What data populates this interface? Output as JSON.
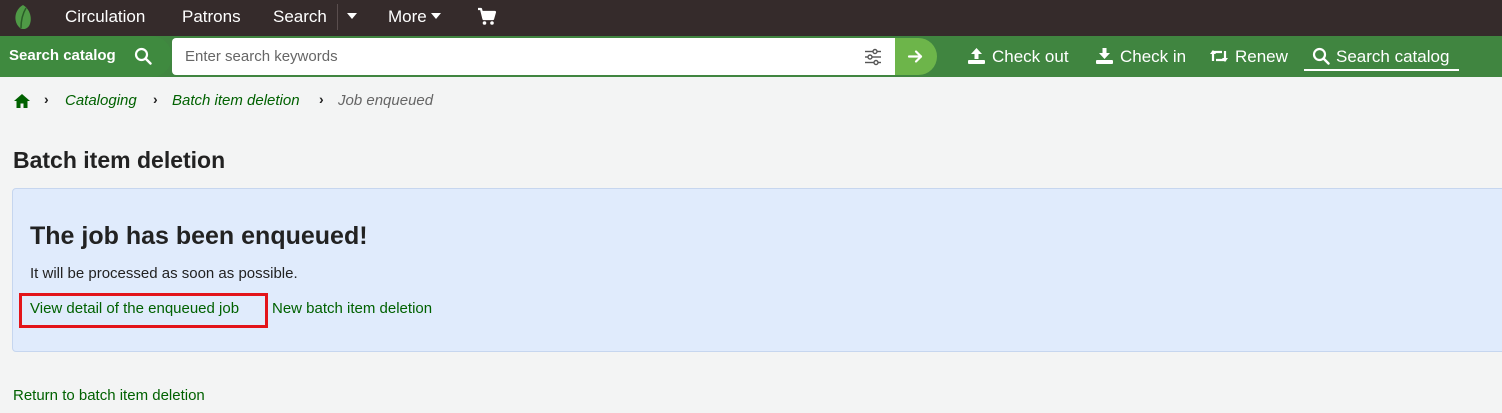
{
  "topnav": {
    "items": [
      {
        "label": "Circulation"
      },
      {
        "label": "Patrons"
      },
      {
        "label": "Search"
      },
      {
        "label": "More"
      }
    ],
    "cart_icon": "cart-icon",
    "logo_icon": "koha-leaf-logo"
  },
  "searchbar": {
    "tab_label": "Search catalog",
    "placeholder": "Enter search keywords",
    "value": "",
    "quick_links": [
      {
        "label": "Check out",
        "icon": "upload-icon"
      },
      {
        "label": "Check in",
        "icon": "download-icon"
      },
      {
        "label": "Renew",
        "icon": "retweet-icon"
      },
      {
        "label": "Search catalog",
        "icon": "search-icon"
      }
    ],
    "colors": {
      "bar": "#408540",
      "go": "#6db54a",
      "nav": "#352b2b"
    }
  },
  "breadcrumb": {
    "items": [
      {
        "label": "Cataloging"
      },
      {
        "label": "Batch item deletion"
      }
    ],
    "current": "Job enqueued"
  },
  "page": {
    "title": "Batch item deletion"
  },
  "panel": {
    "heading": "The job has been enqueued!",
    "text": "It will be processed as soon as possible.",
    "view_link": "View detail of the enqueued job",
    "new_link": "New batch item deletion",
    "background": "#e0ebfc",
    "highlight_color": "#e3141a"
  },
  "footer": {
    "return_link": "Return to batch item deletion"
  }
}
